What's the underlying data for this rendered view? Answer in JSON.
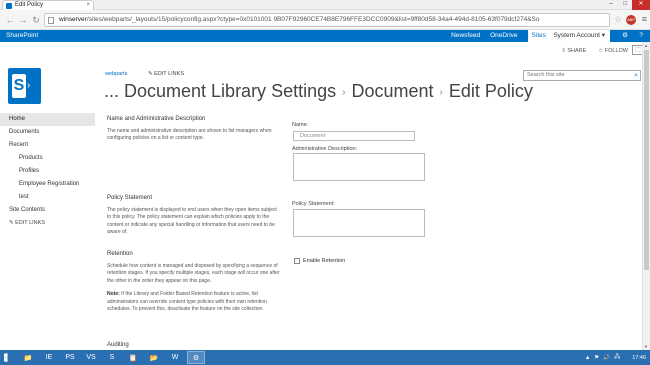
{
  "browser": {
    "tab_title": "Edit Policy",
    "tab_close": "×",
    "window_controls": [
      "–",
      "□",
      "✕"
    ],
    "url_host": "winserver",
    "url_path": "/sites/webparts/_layouts/15/policyconfig.aspx?ctype=0x0101001 9B07F92960CE74B8E796FFE3DCC0909&list=9ff80d58-34a4-494d-8105-63f079dcf274&So",
    "back": "←",
    "forward": "→",
    "reload": "↻",
    "star": "☆",
    "ext_badge": "ABP",
    "menu": "≡"
  },
  "suitebar": {
    "brand": "SharePoint",
    "links": [
      "Newsfeed",
      "OneDrive",
      "Sites"
    ],
    "active_link": "Sites",
    "account": "System Account ▾",
    "gear": "⚙",
    "help": "?"
  },
  "page_actions": {
    "share": "SHARE",
    "follow": "FOLLOW"
  },
  "header": {
    "breadcrumb_site": "webparts",
    "edit_links": "EDIT LINKS",
    "title_parts": [
      "... Document Library Settings",
      "Document",
      "Edit Policy"
    ],
    "separator": "›",
    "search_placeholder": "Search this site"
  },
  "quicklaunch": {
    "items": [
      {
        "label": "Home",
        "level": 0,
        "selected": true
      },
      {
        "label": "Documents",
        "level": 0,
        "selected": false
      },
      {
        "label": "Recent",
        "level": 0,
        "selected": false
      },
      {
        "label": "Products",
        "level": 1,
        "selected": false
      },
      {
        "label": "Profiles",
        "level": 1,
        "selected": false
      },
      {
        "label": "Employee Registration",
        "level": 1,
        "selected": false
      },
      {
        "label": "test",
        "level": 1,
        "selected": false
      },
      {
        "label": "Site Contents",
        "level": 0,
        "selected": false
      }
    ],
    "edit_links": "EDIT LINKS"
  },
  "sections": {
    "name_desc": {
      "heading": "Name and Administrative Description",
      "body": "The name and administrative description are shown to list managers when configuring policies on a list or content type."
    },
    "policy_statement": {
      "heading": "Policy Statement",
      "body": "The policy statement is displayed to end users when they open items subject to this policy. The policy statement can explain which policies apply to the content or indicate any special handling or information that users need to be aware of."
    },
    "retention": {
      "heading": "Retention",
      "body": "Schedule how content is managed and disposed by specifying a sequence of retention stages. If you specify multiple stages, each stage will occur one after the other in the order they appear on this page.",
      "note_label": "Note:",
      "note": " If the Library and Folder Based Retention feature is active, list administrators can override content type policies with their own retention schedules. To prevent this, deactivate the feature on the site collection."
    },
    "auditing": {
      "heading": "Auditing"
    }
  },
  "form": {
    "name_label": "Name:",
    "name_value": "Document",
    "admin_desc_label": "Administrative Description:",
    "policy_statement_label": "Policy Statement:",
    "enable_retention_label": "Enable Retention"
  },
  "taskbar": {
    "start": "",
    "buttons": [
      "📁",
      "IE",
      "PS",
      "VS",
      "S",
      "📋",
      "📂",
      "W",
      "⚙"
    ],
    "tray_icons": [
      "▲",
      "⚑",
      "🔊",
      "🖧"
    ],
    "clock": "17:46"
  }
}
